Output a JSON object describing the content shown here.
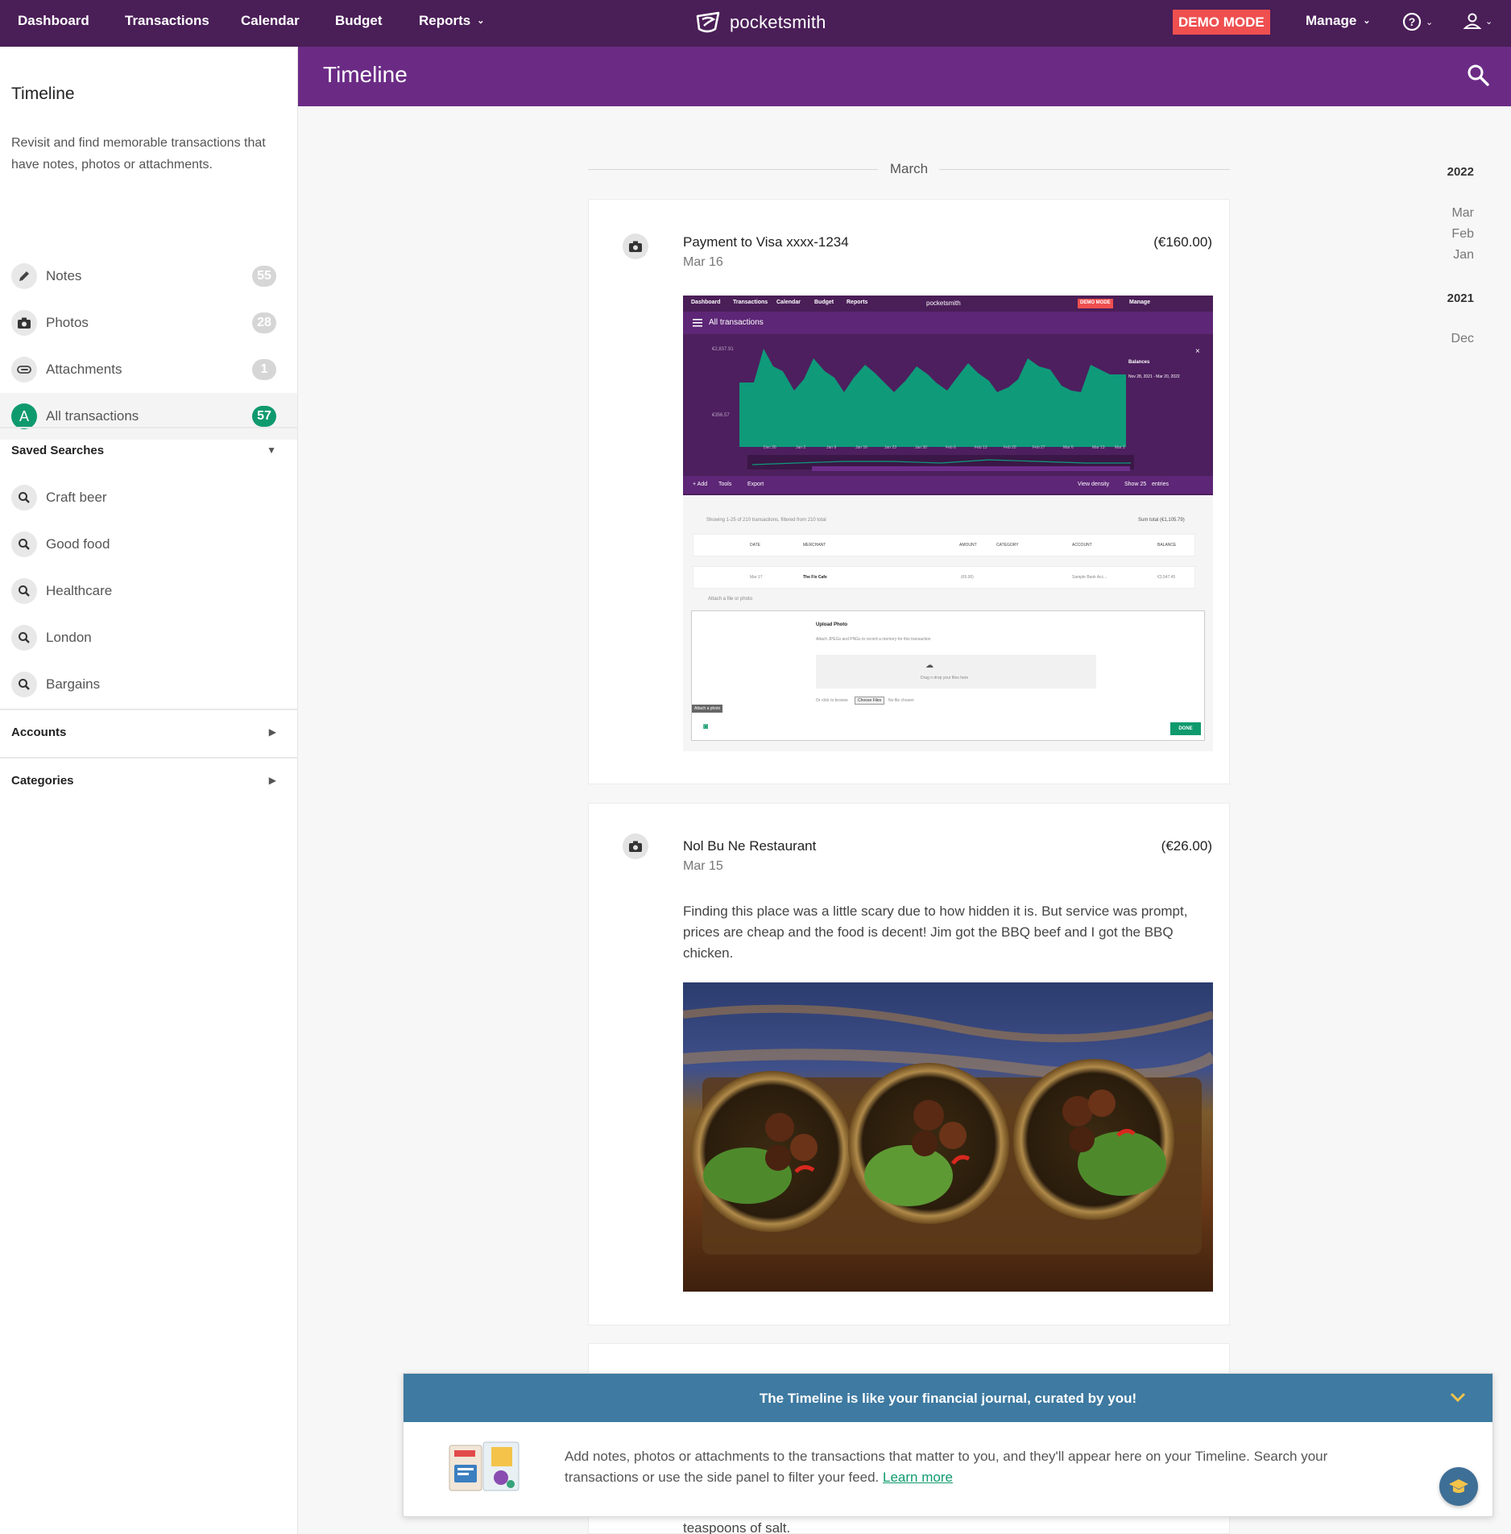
{
  "nav": {
    "items": [
      "Dashboard",
      "Transactions",
      "Calendar",
      "Budget",
      "Reports"
    ],
    "brand": "pocketsmith",
    "demo_badge": "DEMO MODE",
    "manage": "Manage"
  },
  "sidebar": {
    "title": "Timeline",
    "description": "Revisit and find memorable transactions that have notes, photos or attachments.",
    "filters": [
      {
        "label": "Notes",
        "count": "55",
        "icon": "pencil-icon"
      },
      {
        "label": "Photos",
        "count": "28",
        "icon": "camera-icon"
      },
      {
        "label": "Attachments",
        "count": "1",
        "icon": "paperclip-icon"
      },
      {
        "label": "All transactions",
        "count": "57",
        "icon": "letter-a-icon",
        "letter": "A"
      }
    ],
    "saved_searches_title": "Saved Searches",
    "saved_searches": [
      "Craft beer",
      "Good food",
      "Healthcare",
      "London",
      "Bargains"
    ],
    "accounts_title": "Accounts",
    "categories_title": "Categories"
  },
  "header": {
    "title": "Timeline"
  },
  "timeline": {
    "month": "March",
    "entries": [
      {
        "name": "Payment to Visa xxxx-1234",
        "date": "Mar 16",
        "amount": "(€160.00)"
      },
      {
        "name": "Nol Bu Ne Restaurant",
        "date": "Mar 15",
        "amount": "(€26.00)",
        "note": "Finding this place was a little scary due to how hidden it is. But service was prompt, prices are cheap and the food is decent! Jim got the BBQ beef and I got the BBQ chicken."
      }
    ],
    "tail_text": "teaspoons of salt."
  },
  "embedded_screenshot": {
    "nav": [
      "Dashboard",
      "Transactions",
      "Calendar",
      "Budget",
      "Reports",
      "pocketsmith",
      "DEMO MODE",
      "Manage"
    ],
    "title": "All transactions",
    "balances": "Balances",
    "range": "Nov 28, 2021 - Mar 20, 2022",
    "ymax": "€2,837.91",
    "ymin": "€356.57",
    "xticks": [
      "Dec 26",
      "Jan 2",
      "Jan 9",
      "Jan 16",
      "Jan 23",
      "Jan 30",
      "Feb 6",
      "Feb 13",
      "Feb 20",
      "Feb 27",
      "Mar 6",
      "Mar 13",
      "Mar 2"
    ],
    "toolbar": [
      "+ Add",
      "Tools",
      "Export",
      "View density",
      "Show 25",
      "entries"
    ],
    "showing": "Showing 1-25 of 210 transactions, filtered from 210 total",
    "sum": "Sum total (€1,105.79)",
    "columns": [
      "DATE",
      "MERCHANT",
      "AMOUNT",
      "CATEGORY",
      "ACCOUNT",
      "BALANCE"
    ],
    "row": [
      "Mar 17",
      "The Fix Cafe",
      "(€6.00)",
      "Sample Bank Acc...",
      "€3,547.45"
    ],
    "attach": "Attach a file or photo",
    "upload_title": "Upload Photo",
    "upload_desc": "Attach JPEGs and PNGs to record a memory for this transaction",
    "drag": "Drag n drop your files here",
    "browse": "Or click to browse",
    "choose": "Choose Files",
    "no_file": "No file chosen",
    "attach_photo": "Attach a photo",
    "done": "DONE"
  },
  "years": [
    {
      "year": "2022",
      "months": [
        "Mar",
        "Feb",
        "Jan"
      ]
    },
    {
      "year": "2021",
      "months": [
        "Dec"
      ]
    }
  ],
  "info_panel": {
    "title": "The Timeline is like your financial journal, curated by you!",
    "text": "Add notes, photos or attachments to the transactions that matter to you, and they'll appear here on your Timeline. Search your transactions or use the side panel to filter your feed.",
    "link": "Learn more"
  },
  "colors": {
    "nav": "#4a1e57",
    "header": "#6b2b85",
    "accent": "#0f9a6e",
    "demo": "#ef4f4f",
    "info": "#3e7aa1"
  }
}
